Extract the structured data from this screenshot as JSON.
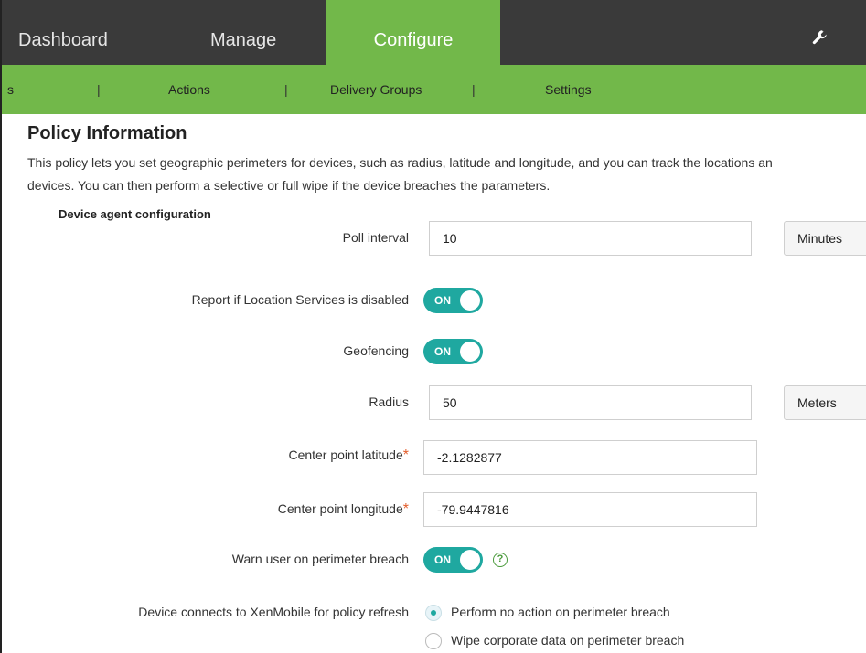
{
  "topnav": {
    "tabs": [
      {
        "label": "Dashboard"
      },
      {
        "label": "Manage"
      },
      {
        "label": "Configure"
      }
    ],
    "settings_icon": "wrench-icon"
  },
  "subnav": {
    "items": [
      {
        "label": "s"
      },
      {
        "label": "Actions"
      },
      {
        "label": "Delivery Groups"
      },
      {
        "label": "Settings"
      }
    ],
    "separator": "|"
  },
  "page": {
    "title": "Policy Information",
    "description_line1": "This policy lets you set geographic perimeters for devices, such as radius, latitude and longitude, and you can track the locations an",
    "description_line2": "devices. You can then perform a selective or full wipe if the device breaches the parameters.",
    "section_heading": "Device agent configuration"
  },
  "fields": {
    "poll_interval": {
      "label": "Poll interval",
      "value": "10",
      "unit": "Minutes"
    },
    "report_location": {
      "label": "Report if Location Services is disabled",
      "state": "ON"
    },
    "geofencing": {
      "label": "Geofencing",
      "state": "ON"
    },
    "radius": {
      "label": "Radius",
      "value": "50",
      "unit": "Meters"
    },
    "latitude": {
      "label": "Center point latitude",
      "required": "*",
      "value": "-2.1282877"
    },
    "longitude": {
      "label": "Center point longitude",
      "required": "*",
      "value": "-79.9447816"
    },
    "warn_user": {
      "label": "Warn user on perimeter breach",
      "state": "ON",
      "help": "?"
    },
    "policy_refresh": {
      "label": "Device connects to XenMobile for policy refresh",
      "options": [
        {
          "label": "Perform no action on perimeter breach",
          "selected": true
        },
        {
          "label": "Wipe corporate data on perimeter breach",
          "selected": false
        }
      ]
    }
  },
  "colors": {
    "nav_bg": "#3a3a3a",
    "accent_green": "#72b84a",
    "toggle_teal": "#1fa8a0",
    "required_orange": "#e35d2b"
  }
}
